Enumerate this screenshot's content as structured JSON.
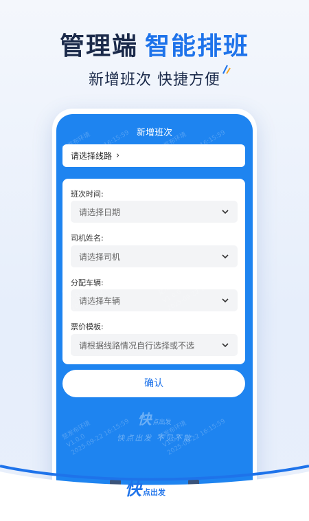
{
  "headline": {
    "part1": "管理端",
    "part2": "智能排班"
  },
  "subline": "新增班次 快捷方便",
  "screen": {
    "title": "新增班次",
    "route": {
      "label": "请选择线路",
      "chevron": "›"
    },
    "fields": [
      {
        "label": "班次时间:",
        "placeholder": "请选择日期"
      },
      {
        "label": "司机姓名:",
        "placeholder": "请选择司机"
      },
      {
        "label": "分配车辆:",
        "placeholder": "请选择车辆"
      },
      {
        "label": "票价模板:",
        "placeholder": "请根据线路情况自行选择或不选"
      }
    ],
    "confirm_label": "确认",
    "brand_logo": "快",
    "brand_sub": "点出发",
    "slogan": "快点出发 不见不散",
    "watermark": {
      "line1": "楚发布环境",
      "line2": "V1.0.0",
      "line3": "2025-09-22 16:15:59"
    }
  },
  "bottom_brand": {
    "logo": "快",
    "sub": "点出发"
  },
  "colors": {
    "accent": "#1e73ea",
    "screen_bg": "#1e84f0",
    "dark_text": "#1b2a4a"
  }
}
